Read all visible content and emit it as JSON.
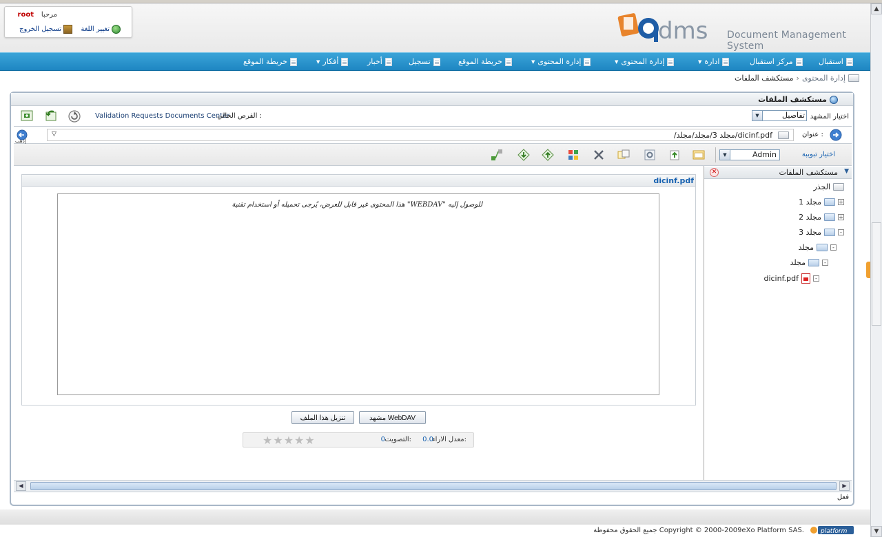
{
  "header": {
    "welcome": "مرحبا",
    "username": "root",
    "change_language": "تغيير اللغة",
    "logout": "تسجيل الخروج",
    "tagline": "Document Management System"
  },
  "nav": {
    "items": [
      {
        "label": "استقبال",
        "has_menu": false
      },
      {
        "label": "مركز استقبال",
        "has_menu": false
      },
      {
        "label": "ادارة",
        "has_menu": true
      },
      {
        "label": "إدارة المحتوى",
        "has_menu": true
      },
      {
        "label": "إدارة المحتوى",
        "has_menu": true
      },
      {
        "label": "خريطة الموقع",
        "has_menu": false
      },
      {
        "label": "تسجيل",
        "has_menu": false
      },
      {
        "label": "أخبار",
        "has_menu": false
      },
      {
        "label": "أفكار",
        "has_menu": true
      },
      {
        "label": "خريطة الموقع",
        "has_menu": false
      }
    ]
  },
  "breadcrumb": {
    "parent": "إدارة المحتوى",
    "separator": "›",
    "current": "مستكشف الملفات"
  },
  "panel": {
    "title": "مستكشف الملفات",
    "view_label": "اختيار المشهد",
    "view_value": "تفاصيل",
    "current_drive_label": "القرص الحالي :",
    "current_drive_value": "Validation Requests Documents Center",
    "address_label": "عنوان :",
    "address_value": "/مجلد 3/مجلد/مجلد/dicinf.pdf",
    "go_label": "إذهب",
    "rollup_label": "اختيار تبويبة",
    "rollup_value": "Admin"
  },
  "tree": {
    "header": "مستكشف الملفات",
    "root": "الجذر",
    "nodes": [
      {
        "label": "مجلد 1",
        "expander": "+"
      },
      {
        "label": "مجلد 2",
        "expander": "+"
      },
      {
        "label": "مجلد 3",
        "expander": "-"
      },
      {
        "label": "مجلد",
        "expander": "-"
      },
      {
        "label": "مجلد",
        "expander": "-"
      },
      {
        "label": "dicinf.pdf",
        "expander": "-"
      }
    ]
  },
  "content": {
    "file_name": "dicinf.pdf",
    "message": "هذا المحتوى غير قابل للعرض، يُرجى تحميله أو استخدام تقنية \"WEBDAV\" للوصول إليه",
    "download_button": "تنزيل هذا الملف",
    "webdav_button": "مشهد WebDAV",
    "rating_label": "معدل الاراء:",
    "rating_value": "0.0",
    "votes_label": "التصويت:",
    "votes_value": "0",
    "stars": "★★★★★",
    "stars_filled": 0
  },
  "statusbar": {
    "text": "فعل"
  },
  "footer": {
    "copyright": "جميع الحقوق محفوظة Copyright © 2000-2009eXo Platform SAS.",
    "brand": "platform"
  },
  "colors": {
    "nav_bar": "#1e86c2",
    "link": "#1560b0",
    "username": "#c00000"
  }
}
